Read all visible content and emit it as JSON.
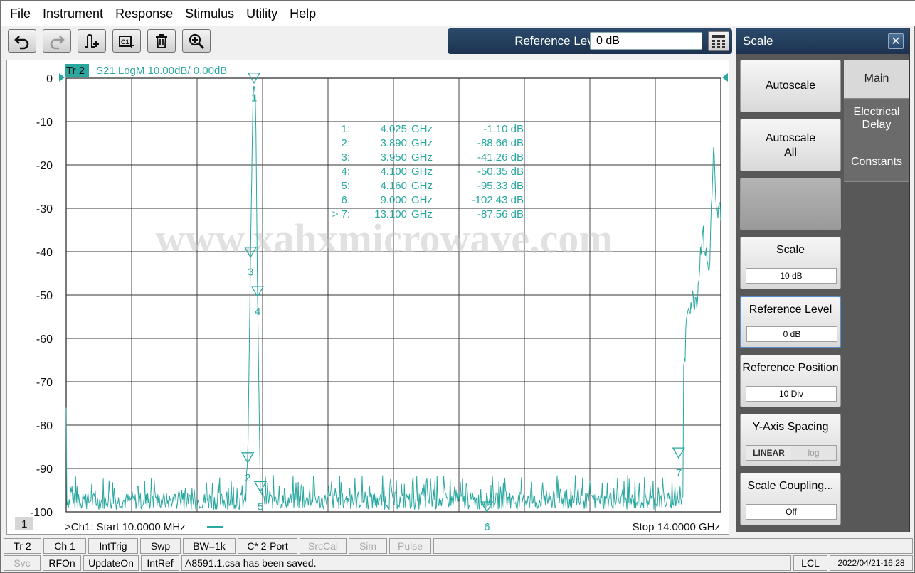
{
  "menu": [
    "File",
    "Instrument",
    "Response",
    "Stimulus",
    "Utility",
    "Help"
  ],
  "toolbar": {
    "buttons": [
      "undo-icon",
      "redo-icon",
      "add-trace-icon",
      "add-channel-icon",
      "delete-icon",
      "zoom-icon"
    ],
    "ref_label": "Reference Level",
    "ref_value": "0 dB"
  },
  "trace": {
    "tag": "Tr 2",
    "info": "S21 LogM 10.00dB/  0.00dB",
    "channel_number": "1",
    "start": ">Ch1:  Start   10.0000 MHz",
    "stop": "Stop  14.0000 GHz",
    "color": "#2aa8a0"
  },
  "markers_table": [
    {
      "num": "1:",
      "freq": "4.025",
      "unit": "GHz",
      "val": "-1.10 dB"
    },
    {
      "num": "2:",
      "freq": "3.890",
      "unit": "GHz",
      "val": "-88.66 dB"
    },
    {
      "num": "3:",
      "freq": "3.950",
      "unit": "GHz",
      "val": "-41.26 dB"
    },
    {
      "num": "4:",
      "freq": "4.100",
      "unit": "GHz",
      "val": "-50.35 dB"
    },
    {
      "num": "5:",
      "freq": "4.160",
      "unit": "GHz",
      "val": "-95.33 dB"
    },
    {
      "num": "6:",
      "freq": "9.000",
      "unit": "GHz",
      "val": "-102.43 dB"
    },
    {
      "num": "> 7:",
      "freq": "13.100",
      "unit": "GHz",
      "val": "-87.56 dB"
    }
  ],
  "watermark": "www.xahxmicrowave.com",
  "chart_data": {
    "type": "line",
    "title": "S21 LogM 10.00dB/  0.00dB",
    "xlabel": "",
    "ylabel": "",
    "xlim": [
      0.01,
      14.0
    ],
    "ylim": [
      -100,
      0
    ],
    "yticks": [
      "0",
      "-10",
      "-20",
      "-30",
      "-40",
      "-50",
      "-60",
      "-70",
      "-80",
      "-90",
      "-100"
    ],
    "grid": true,
    "series": [
      {
        "name": "S21",
        "x": [
          0.01,
          0.05,
          0.5,
          1.0,
          2.0,
          3.0,
          3.8,
          3.89,
          3.95,
          4.0,
          4.025,
          4.06,
          4.1,
          4.16,
          4.3,
          5.0,
          6.0,
          7.0,
          8.0,
          9.0,
          10.0,
          11.0,
          12.0,
          12.8,
          13.1,
          13.3,
          13.5,
          13.6,
          13.75,
          13.85,
          13.9,
          14.0
        ],
        "y": [
          -77,
          -96,
          -98,
          -97,
          -96,
          -96,
          -97,
          -88.66,
          -41.26,
          -5,
          -1.1,
          -5,
          -50.35,
          -95.33,
          -98,
          -98,
          -97,
          -98,
          -97,
          -102.43,
          -97,
          -98,
          -98,
          -96,
          -87.56,
          -52,
          -50,
          -35,
          -45,
          -16,
          -32,
          -30
        ]
      }
    ],
    "markers": [
      {
        "label": "1",
        "x": 4.025,
        "y": -1.1
      },
      {
        "label": "2",
        "x": 3.89,
        "y": -88.66
      },
      {
        "label": "3",
        "x": 3.95,
        "y": -41.26
      },
      {
        "label": "4",
        "x": 4.1,
        "y": -50.35
      },
      {
        "label": "5",
        "x": 4.16,
        "y": -95.33
      },
      {
        "label": "6",
        "x": 9.0,
        "y": -102.43
      },
      {
        "label": "7",
        "x": 13.1,
        "y": -87.56
      }
    ]
  },
  "panel": {
    "title": "Scale",
    "tabs": [
      "Main",
      "Electrical Delay",
      "Constants"
    ],
    "buttons": [
      {
        "label": "Autoscale",
        "value": ""
      },
      {
        "label": "Autoscale All",
        "value": ""
      },
      {
        "label": "",
        "value": ""
      },
      {
        "label": "Scale",
        "value": "10 dB"
      },
      {
        "label": "Reference Level",
        "value": "0 dB"
      },
      {
        "label": "Reference Position",
        "value": "10 Div"
      },
      {
        "label": "Y-Axis Spacing",
        "value": ""
      },
      {
        "label": "Scale Coupling...",
        "value": "Off"
      }
    ],
    "y_axis_options": [
      "LINEAR",
      "log"
    ]
  },
  "status1": [
    "Tr 2",
    "Ch 1",
    "IntTrig",
    "Swp",
    "BW=1k",
    "C* 2-Port",
    "SrcCal",
    "Sim",
    "Pulse"
  ],
  "status2": [
    "Svc",
    "RFOn",
    "UpdateOn",
    "IntRef",
    "A8591.1.csa has been saved.",
    "LCL",
    "2022/04/21-16:28"
  ]
}
